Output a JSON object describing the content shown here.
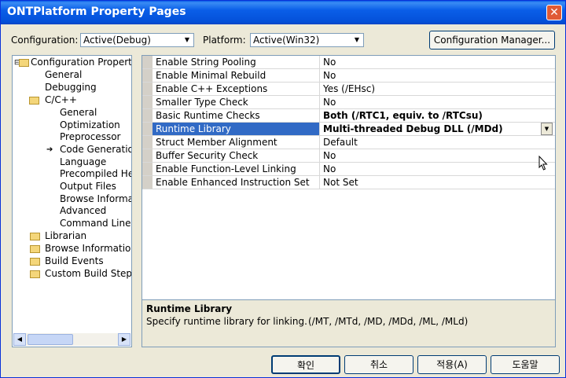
{
  "window": {
    "title": "ONTPlatform Property Pages",
    "close_glyph": "✕"
  },
  "toolbar": {
    "configuration_label": "Configuration:",
    "configuration_value": "Active(Debug)",
    "platform_label": "Platform:",
    "platform_value": "Active(Win32)",
    "config_manager_label": "Configuration Manager..."
  },
  "tree": {
    "root": "Configuration Properties",
    "general": "General",
    "debugging": "Debugging",
    "cpp": "C/C++",
    "cpp_items": [
      "General",
      "Optimization",
      "Preprocessor",
      "Code Generation",
      "Language",
      "Precompiled Headers",
      "Output Files",
      "Browse Information",
      "Advanced",
      "Command Line"
    ],
    "selected_child": "Code Generation",
    "folders": [
      "Librarian",
      "Browse Information",
      "Build Events",
      "Custom Build Step"
    ]
  },
  "properties": [
    {
      "name": "Enable String Pooling",
      "value": "No"
    },
    {
      "name": "Enable Minimal Rebuild",
      "value": "No"
    },
    {
      "name": "Enable C++ Exceptions",
      "value": "Yes (/EHsc)"
    },
    {
      "name": "Smaller Type Check",
      "value": "No"
    },
    {
      "name": "Basic Runtime Checks",
      "value": "Both (/RTC1, equiv. to /RTCsu)"
    },
    {
      "name": "Runtime Library",
      "value": "Multi-threaded Debug DLL (/MDd)"
    },
    {
      "name": "Struct Member Alignment",
      "value": "Default"
    },
    {
      "name": "Buffer Security Check",
      "value": "No"
    },
    {
      "name": "Enable Function-Level Linking",
      "value": "No"
    },
    {
      "name": "Enable Enhanced Instruction Set",
      "value": "Not Set"
    }
  ],
  "selected_property": "Runtime Library",
  "description": {
    "title": "Runtime Library",
    "text": "Specify runtime library for linking.",
    "options": "(/MT, /MTd, /MD, /MDd, /ML, /MLd)"
  },
  "buttons": {
    "ok": "확인",
    "cancel": "취소",
    "apply": "적용(A)",
    "help": "도움말"
  },
  "colors": {
    "title_bar": "#0a5ee8",
    "selection": "#316ac5",
    "dialog_bg": "#ece9d8"
  }
}
